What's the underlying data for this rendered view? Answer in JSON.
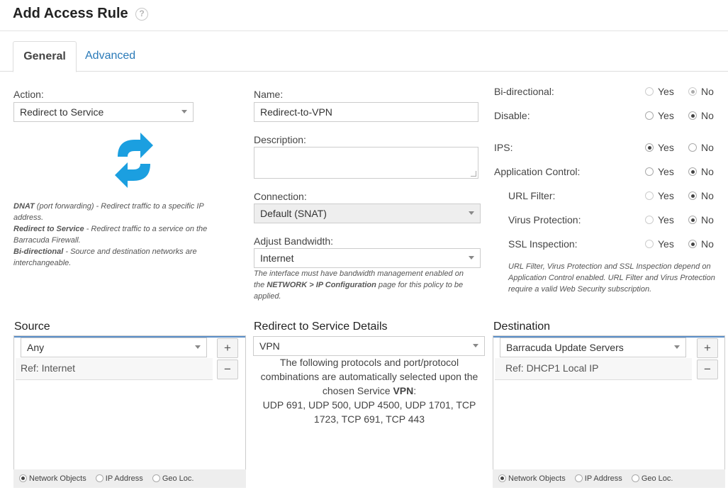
{
  "header": {
    "title": "Add Access Rule",
    "help_glyph": "?"
  },
  "tabs": [
    {
      "label": "General",
      "active": true
    },
    {
      "label": "Advanced",
      "active": false
    }
  ],
  "action": {
    "label": "Action:",
    "value": "Redirect to Service",
    "icon": "redirect-arrows-icon",
    "help": [
      {
        "term": "DNAT",
        "text": " (port forwarding) - Redirect traffic to a specific IP address."
      },
      {
        "term": "Redirect to Service",
        "text": " - Redirect traffic to a service on the Barracuda Firewall."
      },
      {
        "term": "Bi-directional",
        "text": " - Source and destination networks are interchangeable."
      }
    ]
  },
  "name": {
    "label": "Name:",
    "value": "Redirect-to-VPN"
  },
  "description": {
    "label": "Description:",
    "value": ""
  },
  "connection": {
    "label": "Connection:",
    "value": "Default (SNAT)"
  },
  "bandwidth": {
    "label": "Adjust Bandwidth:",
    "value": "Internet",
    "help_pre": "The interface must have bandwidth management enabled on the ",
    "help_bold": "NETWORK > IP Configuration",
    "help_post": " page for this policy to be applied."
  },
  "options": {
    "yes": "Yes",
    "no": "No",
    "bidirectional": {
      "label": "Bi-directional:",
      "value": "No",
      "disabled": true
    },
    "disable": {
      "label": "Disable:",
      "value": "No"
    },
    "ips": {
      "label": "IPS:",
      "value": "Yes"
    },
    "app_control": {
      "label": "Application Control:",
      "value": "No"
    },
    "url_filter": {
      "label": "URL Filter:",
      "value": "No",
      "disabled": true
    },
    "virus": {
      "label": "Virus Protection:",
      "value": "No",
      "disabled": true
    },
    "ssl": {
      "label": "SSL Inspection:",
      "value": "No",
      "disabled": true
    },
    "note": "URL Filter, Virus Protection and SSL Inspection depend on Application Control enabled. URL Filter and Virus Protection require a valid Web Security subscription."
  },
  "source": {
    "title": "Source",
    "value": "Any",
    "ref": "Ref: Internet",
    "add": "+",
    "remove": "−",
    "footer": [
      "Network Objects",
      "IP Address",
      "Geo Loc."
    ]
  },
  "service": {
    "title": "Redirect to Service Details",
    "value": "VPN",
    "text_pre": "The following protocols and port/protocol combinations are automatically selected upon the chosen Service ",
    "service_name": "VPN",
    "text_colon": ":",
    "ports": "UDP 691, UDP 500, UDP 4500, UDP 1701, TCP 1723, TCP 691, TCP 443"
  },
  "destination": {
    "title": "Destination",
    "value": "Barracuda Update Servers",
    "ref": "Ref: DHCP1 Local IP",
    "add": "+",
    "remove": "−",
    "footer": [
      "Network Objects",
      "IP Address",
      "Geo Loc."
    ]
  },
  "colors": {
    "accent": "#5b8fc8",
    "link": "#2a7ab8",
    "icon": "#1b9fe0"
  }
}
